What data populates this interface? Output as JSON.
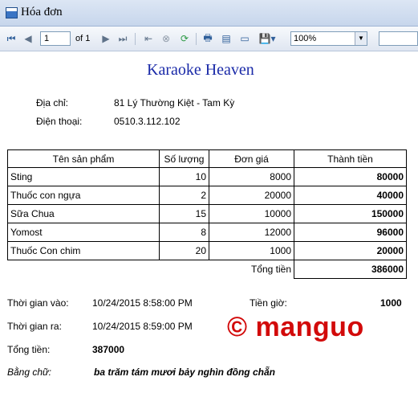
{
  "window": {
    "title": "Hóa đơn"
  },
  "toolbar": {
    "page_current": "1",
    "page_total_label": "of 1",
    "zoom": "100%",
    "find_placeholder": ""
  },
  "report": {
    "store_name": "Karaoke Heaven",
    "address_label": "Địa chỉ:",
    "address_value": "81 Lý Thường Kiệt - Tam Kỳ",
    "phone_label": "Điện thoại:",
    "phone_value": "0510.3.112.102",
    "columns": [
      "Tên sản phẩm",
      "Số lượng",
      "Đơn giá",
      "Thành tiền"
    ],
    "rows": [
      {
        "name": "Sting",
        "qty": "10",
        "price": "8000",
        "amount": "80000"
      },
      {
        "name": "Thuốc con ngựa",
        "qty": "2",
        "price": "20000",
        "amount": "40000"
      },
      {
        "name": "Sữa Chua",
        "qty": "15",
        "price": "10000",
        "amount": "150000"
      },
      {
        "name": "Yomost",
        "qty": "8",
        "price": "12000",
        "amount": "96000"
      },
      {
        "name": "Thuốc Con chim",
        "qty": "20",
        "price": "1000",
        "amount": "20000"
      }
    ],
    "subtotal_label": "Tổng tiền",
    "subtotal_value": "386000",
    "time_in_label": "Thời gian vào:",
    "time_in_value": "10/24/2015 8:58:00 PM",
    "time_out_label": "Thời gian ra:",
    "time_out_value": "10/24/2015 8:59:00 PM",
    "hour_fee_label": "Tiền giờ:",
    "hour_fee_value": "1000",
    "total_label": "Tổng tiền:",
    "total_value": "387000",
    "words_label": "Bằng chữ:",
    "words_value": "ba trăm tám mươi bảy nghìn đồng chẵn"
  },
  "watermark": {
    "text": "© manguo"
  }
}
